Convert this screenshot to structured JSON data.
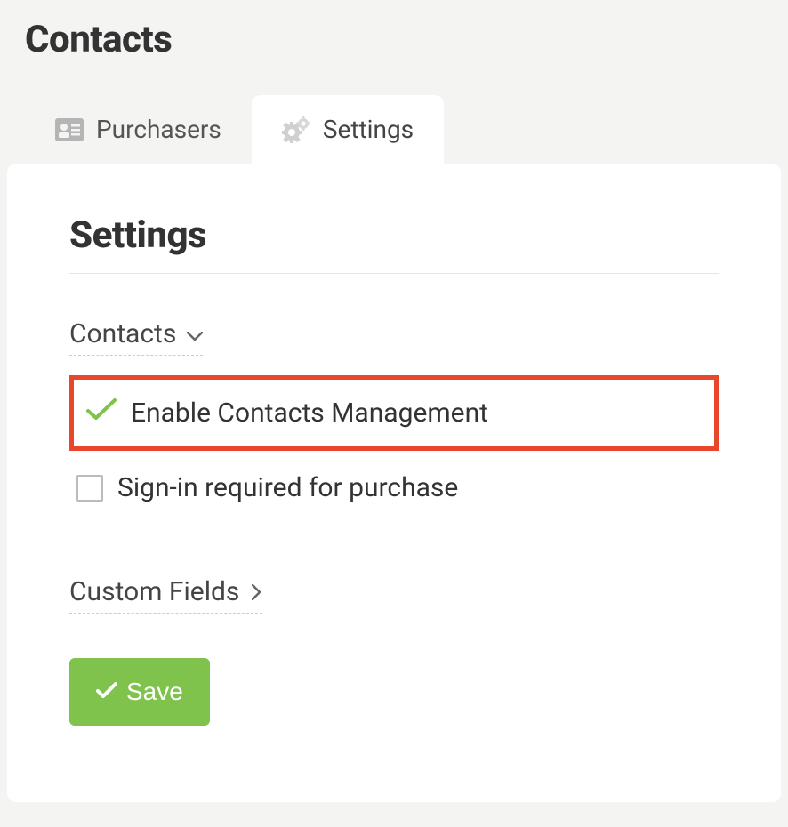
{
  "header": {
    "title": "Contacts"
  },
  "tabs": [
    {
      "label": "Purchasers",
      "icon": "contact-card-icon",
      "active": false
    },
    {
      "label": "Settings",
      "icon": "gears-icon",
      "active": true
    }
  ],
  "content": {
    "title": "Settings",
    "sections": {
      "contacts": {
        "label": "Contacts",
        "options": [
          {
            "label": "Enable Contacts Management",
            "checked": true,
            "highlighted": true
          },
          {
            "label": "Sign-in required for purchase",
            "checked": false,
            "highlighted": false
          }
        ]
      },
      "customFields": {
        "label": "Custom Fields"
      }
    },
    "saveButton": {
      "label": "Save"
    }
  }
}
